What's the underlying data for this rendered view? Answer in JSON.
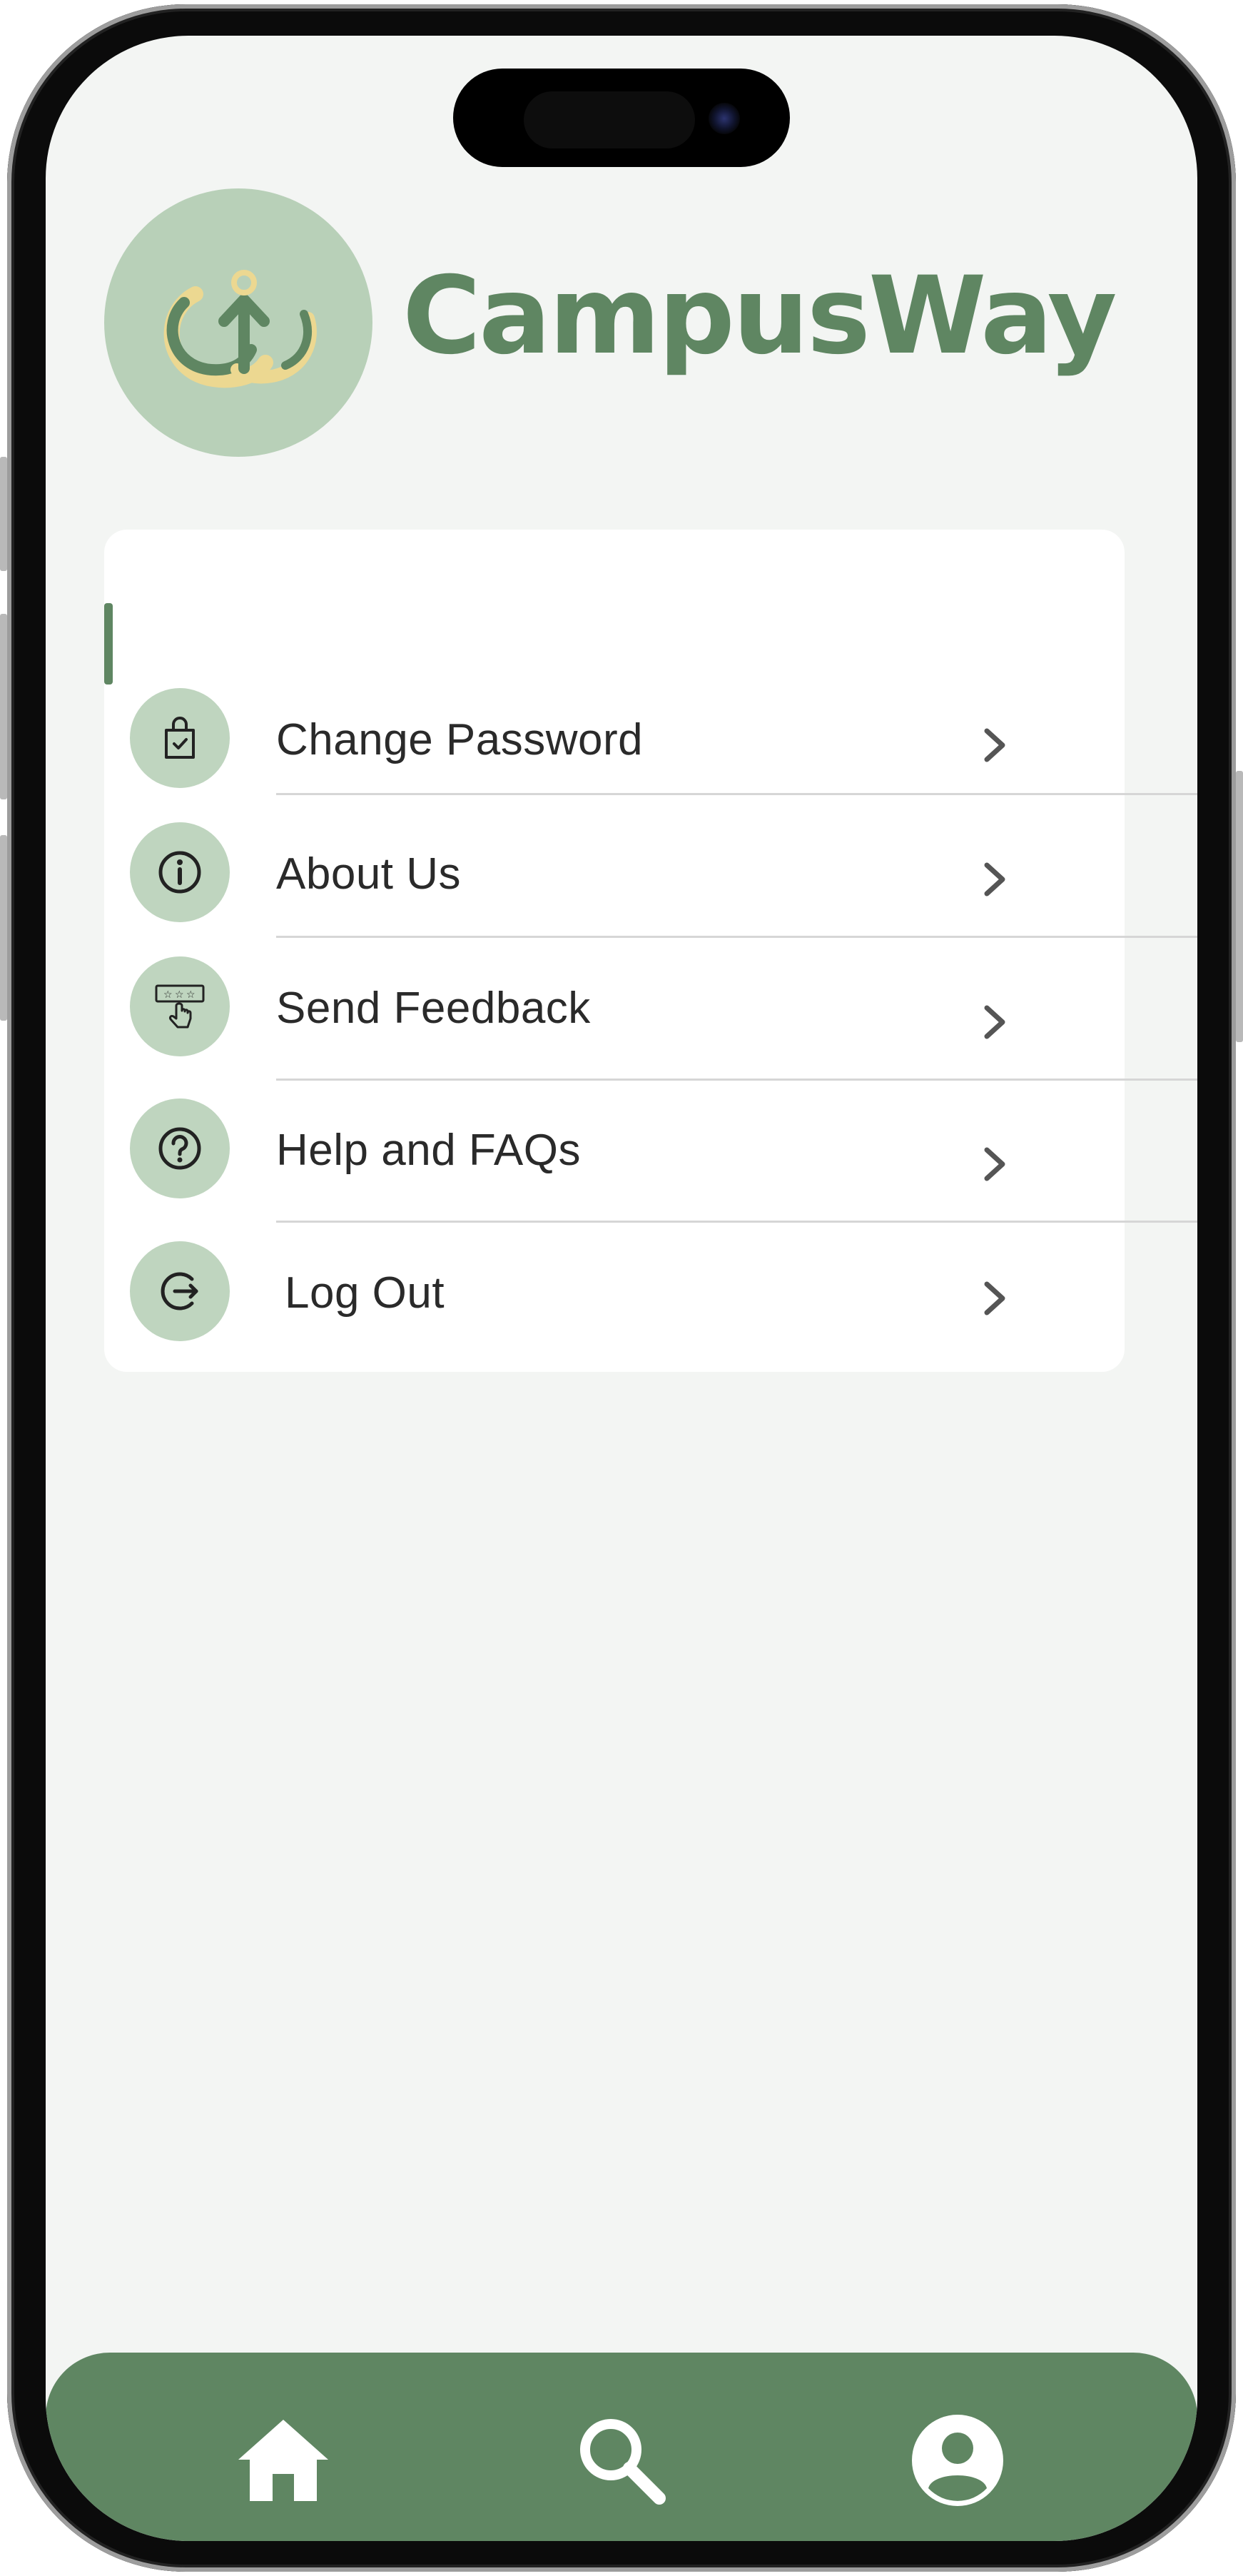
{
  "app": {
    "title": "CampusWay"
  },
  "settings_menu": [
    {
      "label": "Change Password",
      "icon": "password-bag-icon"
    },
    {
      "label": "About Us",
      "icon": "info-icon"
    },
    {
      "label": "Send Feedback",
      "icon": "feedback-rating-icon"
    },
    {
      "label": "Help and FAQs",
      "icon": "help-icon"
    },
    {
      "label": "Log Out",
      "icon": "logout-icon"
    }
  ],
  "bottom_nav": [
    {
      "name": "home",
      "icon": "home-icon"
    },
    {
      "name": "search",
      "icon": "search-icon"
    },
    {
      "name": "profile",
      "icon": "profile-icon"
    }
  ],
  "colors": {
    "brand_green": "#5f8662",
    "icon_circle": "#bfd5bf",
    "logo_circle": "#b8d0b8",
    "logo_gold": "#ecd891",
    "screen_bg": "#f3f5f3"
  }
}
